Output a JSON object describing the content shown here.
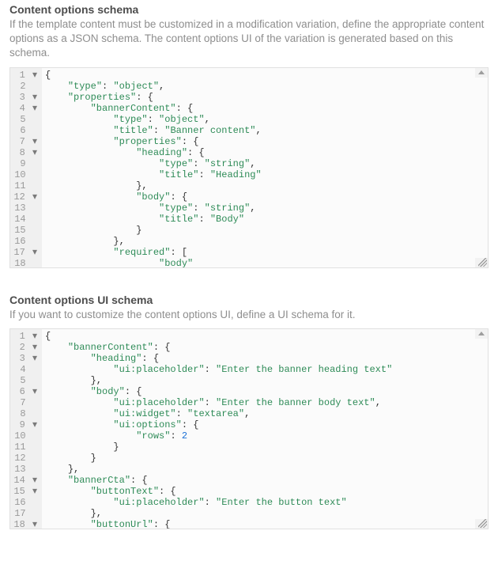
{
  "sections": [
    {
      "id": "schema",
      "title": "Content options schema",
      "description": "If the template content must be customized in a modification variation, define the appropriate content options as a JSON schema. The content options UI of the variation is generated based on this schema.",
      "code": {
        "language": "json",
        "visible_lines": [
          {
            "n": 1,
            "fold": true,
            "indent": 0,
            "tokens": [
              {
                "t": "punc",
                "v": "{"
              }
            ]
          },
          {
            "n": 2,
            "fold": false,
            "indent": 1,
            "tokens": [
              {
                "t": "key",
                "v": "\"type\""
              },
              {
                "t": "punc",
                "v": ": "
              },
              {
                "t": "str",
                "v": "\"object\""
              },
              {
                "t": "punc",
                "v": ","
              }
            ]
          },
          {
            "n": 3,
            "fold": true,
            "indent": 1,
            "tokens": [
              {
                "t": "key",
                "v": "\"properties\""
              },
              {
                "t": "punc",
                "v": ": {"
              }
            ]
          },
          {
            "n": 4,
            "fold": true,
            "indent": 2,
            "tokens": [
              {
                "t": "key",
                "v": "\"bannerContent\""
              },
              {
                "t": "punc",
                "v": ": {"
              }
            ]
          },
          {
            "n": 5,
            "fold": false,
            "indent": 3,
            "tokens": [
              {
                "t": "key",
                "v": "\"type\""
              },
              {
                "t": "punc",
                "v": ": "
              },
              {
                "t": "str",
                "v": "\"object\""
              },
              {
                "t": "punc",
                "v": ","
              }
            ]
          },
          {
            "n": 6,
            "fold": false,
            "indent": 3,
            "tokens": [
              {
                "t": "key",
                "v": "\"title\""
              },
              {
                "t": "punc",
                "v": ": "
              },
              {
                "t": "str",
                "v": "\"Banner content\""
              },
              {
                "t": "punc",
                "v": ","
              }
            ]
          },
          {
            "n": 7,
            "fold": true,
            "indent": 3,
            "tokens": [
              {
                "t": "key",
                "v": "\"properties\""
              },
              {
                "t": "punc",
                "v": ": {"
              }
            ]
          },
          {
            "n": 8,
            "fold": true,
            "indent": 4,
            "tokens": [
              {
                "t": "key",
                "v": "\"heading\""
              },
              {
                "t": "punc",
                "v": ": {"
              }
            ]
          },
          {
            "n": 9,
            "fold": false,
            "indent": 5,
            "tokens": [
              {
                "t": "key",
                "v": "\"type\""
              },
              {
                "t": "punc",
                "v": ": "
              },
              {
                "t": "str",
                "v": "\"string\""
              },
              {
                "t": "punc",
                "v": ","
              }
            ]
          },
          {
            "n": 10,
            "fold": false,
            "indent": 5,
            "tokens": [
              {
                "t": "key",
                "v": "\"title\""
              },
              {
                "t": "punc",
                "v": ": "
              },
              {
                "t": "str",
                "v": "\"Heading\""
              }
            ]
          },
          {
            "n": 11,
            "fold": false,
            "indent": 4,
            "tokens": [
              {
                "t": "punc",
                "v": "},"
              }
            ]
          },
          {
            "n": 12,
            "fold": true,
            "indent": 4,
            "tokens": [
              {
                "t": "key",
                "v": "\"body\""
              },
              {
                "t": "punc",
                "v": ": {"
              }
            ]
          },
          {
            "n": 13,
            "fold": false,
            "indent": 5,
            "tokens": [
              {
                "t": "key",
                "v": "\"type\""
              },
              {
                "t": "punc",
                "v": ": "
              },
              {
                "t": "str",
                "v": "\"string\""
              },
              {
                "t": "punc",
                "v": ","
              }
            ]
          },
          {
            "n": 14,
            "fold": false,
            "indent": 5,
            "tokens": [
              {
                "t": "key",
                "v": "\"title\""
              },
              {
                "t": "punc",
                "v": ": "
              },
              {
                "t": "str",
                "v": "\"Body\""
              }
            ]
          },
          {
            "n": 15,
            "fold": false,
            "indent": 4,
            "tokens": [
              {
                "t": "punc",
                "v": "}"
              }
            ]
          },
          {
            "n": 16,
            "fold": false,
            "indent": 3,
            "tokens": [
              {
                "t": "punc",
                "v": "},"
              }
            ]
          },
          {
            "n": 17,
            "fold": true,
            "indent": 3,
            "tokens": [
              {
                "t": "key",
                "v": "\"required\""
              },
              {
                "t": "punc",
                "v": ": ["
              }
            ]
          },
          {
            "n": 18,
            "fold": false,
            "indent": 5,
            "tokens": [
              {
                "t": "str",
                "v": "\"body\""
              }
            ]
          }
        ]
      }
    },
    {
      "id": "ui-schema",
      "title": "Content options UI schema",
      "description": "If you want to customize the content options UI, define a UI schema for it.",
      "code": {
        "language": "json",
        "visible_lines": [
          {
            "n": 1,
            "fold": true,
            "indent": 0,
            "tokens": [
              {
                "t": "punc",
                "v": "{"
              }
            ]
          },
          {
            "n": 2,
            "fold": true,
            "indent": 1,
            "tokens": [
              {
                "t": "key",
                "v": "\"bannerContent\""
              },
              {
                "t": "punc",
                "v": ": {"
              }
            ]
          },
          {
            "n": 3,
            "fold": true,
            "indent": 2,
            "tokens": [
              {
                "t": "key",
                "v": "\"heading\""
              },
              {
                "t": "punc",
                "v": ": {"
              }
            ]
          },
          {
            "n": 4,
            "fold": false,
            "indent": 3,
            "tokens": [
              {
                "t": "key",
                "v": "\"ui:placeholder\""
              },
              {
                "t": "punc",
                "v": ": "
              },
              {
                "t": "str",
                "v": "\"Enter the banner heading text\""
              }
            ]
          },
          {
            "n": 5,
            "fold": false,
            "indent": 2,
            "tokens": [
              {
                "t": "punc",
                "v": "},"
              }
            ]
          },
          {
            "n": 6,
            "fold": true,
            "indent": 2,
            "tokens": [
              {
                "t": "key",
                "v": "\"body\""
              },
              {
                "t": "punc",
                "v": ": {"
              }
            ]
          },
          {
            "n": 7,
            "fold": false,
            "indent": 3,
            "tokens": [
              {
                "t": "key",
                "v": "\"ui:placeholder\""
              },
              {
                "t": "punc",
                "v": ": "
              },
              {
                "t": "str",
                "v": "\"Enter the banner body text\""
              },
              {
                "t": "punc",
                "v": ","
              }
            ]
          },
          {
            "n": 8,
            "fold": false,
            "indent": 3,
            "tokens": [
              {
                "t": "key",
                "v": "\"ui:widget\""
              },
              {
                "t": "punc",
                "v": ": "
              },
              {
                "t": "str",
                "v": "\"textarea\""
              },
              {
                "t": "punc",
                "v": ","
              }
            ]
          },
          {
            "n": 9,
            "fold": true,
            "indent": 3,
            "tokens": [
              {
                "t": "key",
                "v": "\"ui:options\""
              },
              {
                "t": "punc",
                "v": ": {"
              }
            ]
          },
          {
            "n": 10,
            "fold": false,
            "indent": 4,
            "tokens": [
              {
                "t": "key",
                "v": "\"rows\""
              },
              {
                "t": "punc",
                "v": ": "
              },
              {
                "t": "num",
                "v": "2"
              }
            ]
          },
          {
            "n": 11,
            "fold": false,
            "indent": 3,
            "tokens": [
              {
                "t": "punc",
                "v": "}"
              }
            ]
          },
          {
            "n": 12,
            "fold": false,
            "indent": 2,
            "tokens": [
              {
                "t": "punc",
                "v": "}"
              }
            ]
          },
          {
            "n": 13,
            "fold": false,
            "indent": 1,
            "tokens": [
              {
                "t": "punc",
                "v": "},"
              }
            ]
          },
          {
            "n": 14,
            "fold": true,
            "indent": 1,
            "tokens": [
              {
                "t": "key",
                "v": "\"bannerCta\""
              },
              {
                "t": "punc",
                "v": ": {"
              }
            ]
          },
          {
            "n": 15,
            "fold": true,
            "indent": 2,
            "tokens": [
              {
                "t": "key",
                "v": "\"buttonText\""
              },
              {
                "t": "punc",
                "v": ": {"
              }
            ]
          },
          {
            "n": 16,
            "fold": false,
            "indent": 3,
            "tokens": [
              {
                "t": "key",
                "v": "\"ui:placeholder\""
              },
              {
                "t": "punc",
                "v": ": "
              },
              {
                "t": "str",
                "v": "\"Enter the button text\""
              }
            ]
          },
          {
            "n": 17,
            "fold": false,
            "indent": 2,
            "tokens": [
              {
                "t": "punc",
                "v": "},"
              }
            ]
          },
          {
            "n": 18,
            "fold": true,
            "indent": 2,
            "tokens": [
              {
                "t": "key",
                "v": "\"buttonUrl\""
              },
              {
                "t": "punc",
                "v": ": {"
              }
            ]
          }
        ]
      }
    }
  ]
}
